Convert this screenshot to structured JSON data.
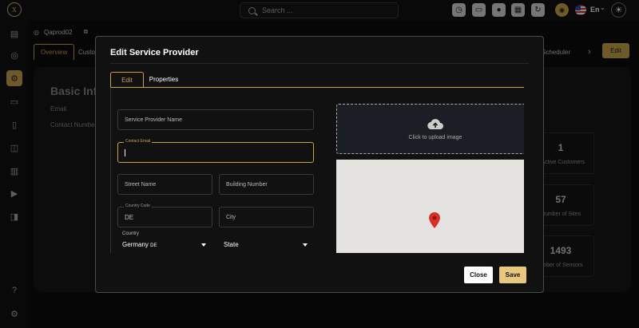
{
  "topbar": {
    "logo": "X",
    "search_placeholder": "Search ...",
    "language": "En",
    "icons": [
      "clock-icon",
      "monitor-icon",
      "user-icon",
      "building-icon",
      "refresh-icon"
    ]
  },
  "sidebar": {
    "icons": [
      "presentation-icon",
      "eye-icon",
      "settings-icon",
      "video-icon",
      "tablet-icon",
      "shapes-icon",
      "map-icon",
      "play-icon",
      "bag-icon",
      "help-icon",
      "gear-icon"
    ]
  },
  "page": {
    "project_name": "Qaprod02",
    "tabs": [
      "Overview",
      "Custo",
      "Scheduler"
    ],
    "edit_label": "Edit",
    "title": "Basic Info",
    "labels": [
      "Email",
      "Contact Number"
    ],
    "stats": [
      {
        "value": "1",
        "label": "n Active Customers"
      },
      {
        "value": "57",
        "label": "Number of Sites"
      },
      {
        "value": "1493",
        "label": "umber of Sensors"
      }
    ]
  },
  "modal": {
    "title": "Edit Service Provider",
    "tabs": {
      "edit": "Edit",
      "properties": "Properties"
    },
    "fields": {
      "service_provider_name": "Service Provider Name",
      "contact_email_label": "Contact Email",
      "street_name": "Street Name",
      "building_number": "Building Number",
      "country_code_label": "Country Code",
      "country_code_value": "DE",
      "city": "City",
      "country_label": "Country",
      "country_value": "Germany",
      "country_suffix": "DE",
      "state": "State"
    },
    "upload_text": "Click to upload image",
    "buttons": {
      "close": "Close",
      "save": "Save"
    }
  },
  "colors": {
    "accent": "#c9a24a",
    "save": "#e8c77a",
    "pin": "#d93025"
  }
}
